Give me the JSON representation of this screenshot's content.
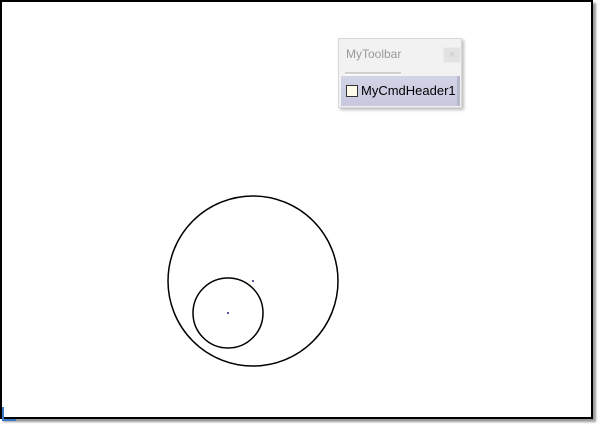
{
  "toolbar": {
    "title": "MyToolbar",
    "close_glyph": "×",
    "command": {
      "label": "MyCmdHeader1",
      "checked": false
    }
  },
  "drawing": {
    "stroke_color": "#000000",
    "center_marker_color": "#5a5aa0",
    "axis_marker_color": "#3c78c8"
  }
}
